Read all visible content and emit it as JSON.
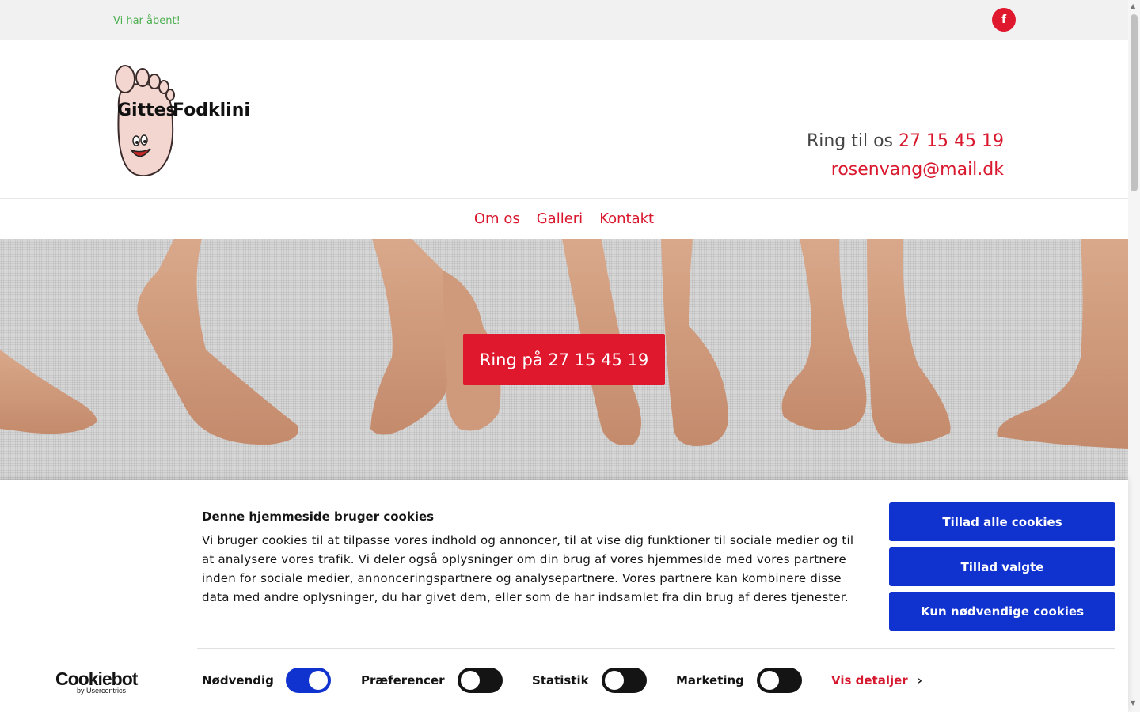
{
  "topbar": {
    "status": "Vi har åbent!",
    "facebook_icon": "f"
  },
  "header": {
    "logo_alt": "Gittes Fodklinik",
    "logo_word1": "Gittes",
    "logo_word2": "Fodklinik",
    "call_prefix": "Ring til os",
    "phone": "27 15 45 19",
    "email": "rosenvang@mail.dk"
  },
  "nav": {
    "items": [
      {
        "label": "Om os"
      },
      {
        "label": "Galleri"
      },
      {
        "label": "Kontakt"
      }
    ]
  },
  "hero": {
    "button_label": "Ring på 27 15 45 19"
  },
  "cookie": {
    "title": "Denne hjemmeside bruger cookies",
    "text": "Vi bruger cookies til at tilpasse vores indhold og annoncer, til at vise dig funktioner til sociale medier og til at analysere vores trafik. Vi deler også oplysninger om din brug af vores hjemmeside med vores partnere inden for sociale medier, annonceringspartnere og analysepartnere. Vores partnere kan kombinere disse data med andre oplysninger, du har givet dem, eller som de har indsamlet fra din brug af deres tjenester.",
    "btn_allow_all": "Tillad alle cookies",
    "btn_allow_selected": "Tillad valgte",
    "btn_necessary_only": "Kun nødvendige cookies",
    "brand_name": "Cookiebot",
    "brand_by": "by Usercentrics",
    "toggles": [
      {
        "label": "Nødvendig",
        "on": true
      },
      {
        "label": "Præferencer",
        "on": false
      },
      {
        "label": "Statistik",
        "on": false
      },
      {
        "label": "Marketing",
        "on": false
      }
    ],
    "details_link": "Vis detaljer",
    "details_chevron": "›"
  },
  "colors": {
    "accent": "#e0182d",
    "cookie_button": "#1032cf",
    "open_text": "#4caf50"
  }
}
